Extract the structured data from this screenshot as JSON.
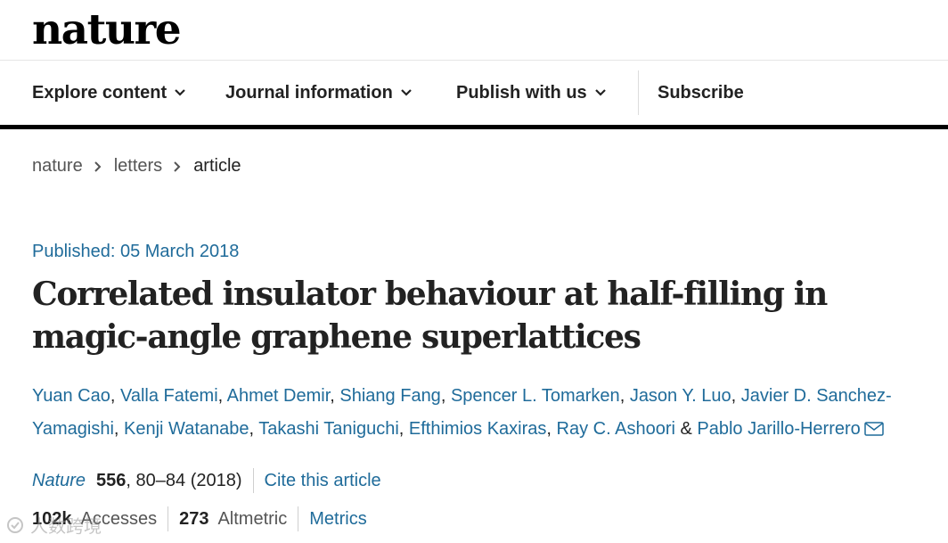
{
  "site": {
    "logo": "nature"
  },
  "nav": {
    "items": [
      {
        "label": "Explore content"
      },
      {
        "label": "Journal information"
      },
      {
        "label": "Publish with us"
      }
    ],
    "subscribe": "Subscribe"
  },
  "breadcrumb": {
    "items": [
      "nature",
      "letters",
      "article"
    ]
  },
  "article": {
    "published": "Published: 05 March 2018",
    "title": "Correlated insulator behaviour at half-filling in magic-angle graphene superlattices",
    "authors": [
      "Yuan Cao",
      "Valla Fatemi",
      "Ahmet Demir",
      "Shiang Fang",
      "Spencer L. Tomarken",
      "Jason Y. Luo",
      "Javier D. Sanchez-Yamagishi",
      "Kenji Watanabe",
      "Takashi Taniguchi",
      "Efthimios Kaxiras",
      "Ray C. Ashoori",
      "Pablo Jarillo-Herrero"
    ],
    "author_separator": ", ",
    "author_last_separator": " & ",
    "journal": "Nature",
    "volume": "556",
    "pages_year": ", 80–84 (2018)",
    "cite_link": "Cite this article"
  },
  "metrics": {
    "accesses_value": "102k",
    "accesses_label": "Accesses",
    "altmetric_value": "273",
    "altmetric_label": "Altmetric",
    "metrics_link": "Metrics"
  },
  "watermark": {
    "text": "人数跨境"
  },
  "colors": {
    "link": "#1f6b9a",
    "text": "#222222",
    "muted": "#555555"
  }
}
